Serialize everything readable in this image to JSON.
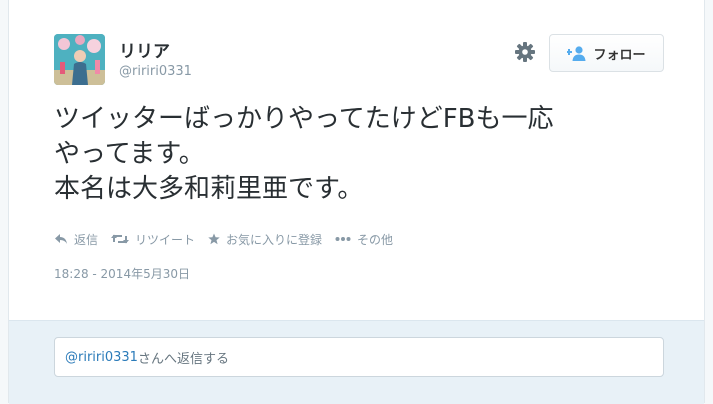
{
  "user": {
    "display_name": "リリア",
    "handle": "@ririri0331"
  },
  "follow_button": {
    "label": "フォロー",
    "icon": "add-user-icon"
  },
  "settings": {
    "icon": "gear-icon"
  },
  "tweet": {
    "lines": [
      "ツイッターばっかりやってたけどFBも一応",
      "やってます。",
      "本名は大多和莉里亜です。"
    ],
    "timestamp": "18:28 - 2014年5月30日"
  },
  "actions": {
    "reply": "返信",
    "retweet": "リツイート",
    "favorite": "お気に入りに登録",
    "more": "その他"
  },
  "reply_box": {
    "mention": "@ririri0331",
    "placeholder_suffix": "さんへ返信する"
  },
  "colors": {
    "text": "#292f33",
    "muted": "#8899a6",
    "link": "#2b7bb9",
    "reply_bg": "#e8f1f7"
  }
}
